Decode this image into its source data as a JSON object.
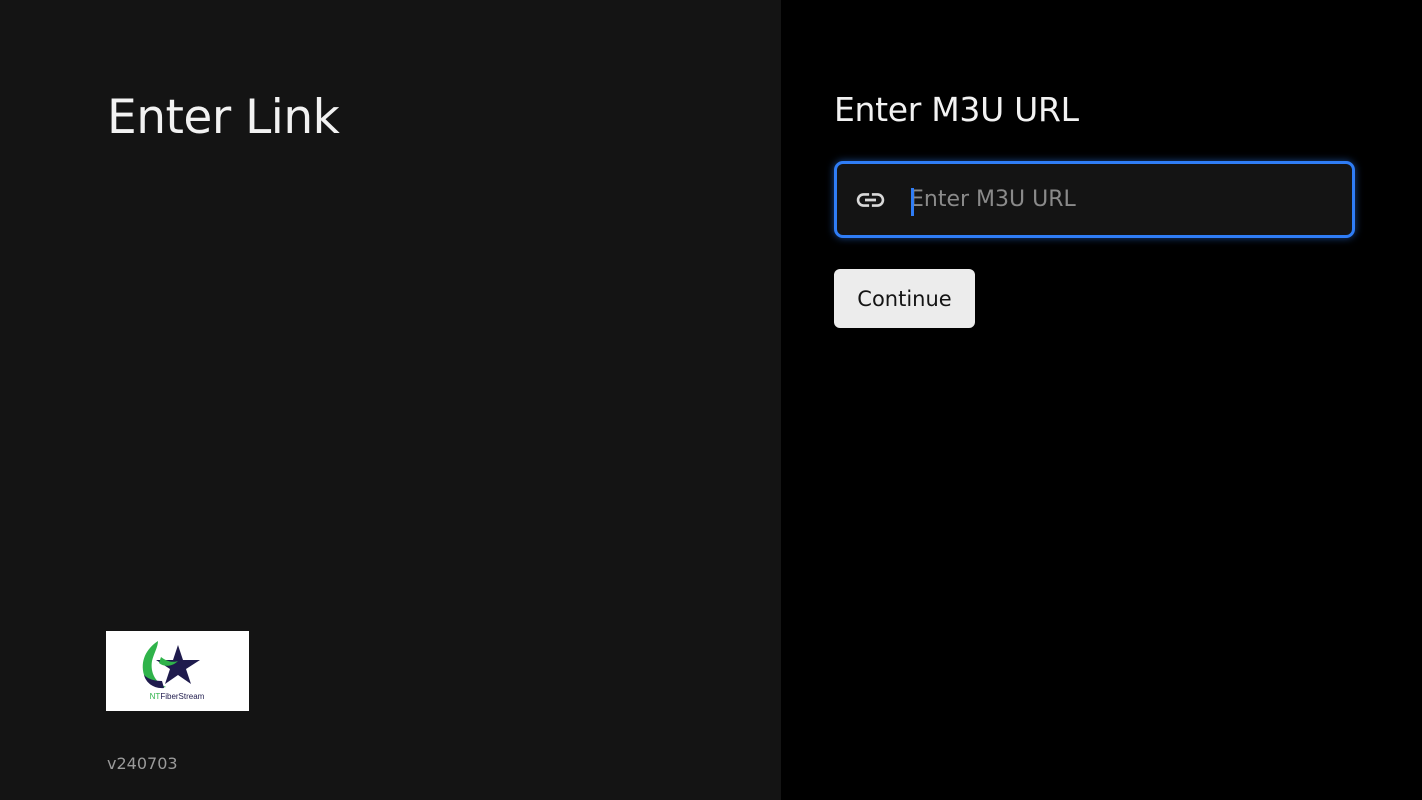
{
  "left_panel": {
    "title": "Enter Link",
    "version": "v240703",
    "logo": {
      "name": "NTFiberStream-logo",
      "text": "NTFiberStream"
    }
  },
  "right_panel": {
    "heading": "Enter M3U URL",
    "url_input": {
      "placeholder": "Enter M3U URL",
      "value": ""
    },
    "continue_label": "Continue"
  },
  "icons": {
    "link": "link-icon"
  },
  "colors": {
    "left_background": "#141414",
    "right_background": "#000000",
    "focus_accent": "#2f7df6",
    "button_background": "#ececec",
    "logo_green": "#2fb34a",
    "logo_navy": "#1f1b4d"
  }
}
